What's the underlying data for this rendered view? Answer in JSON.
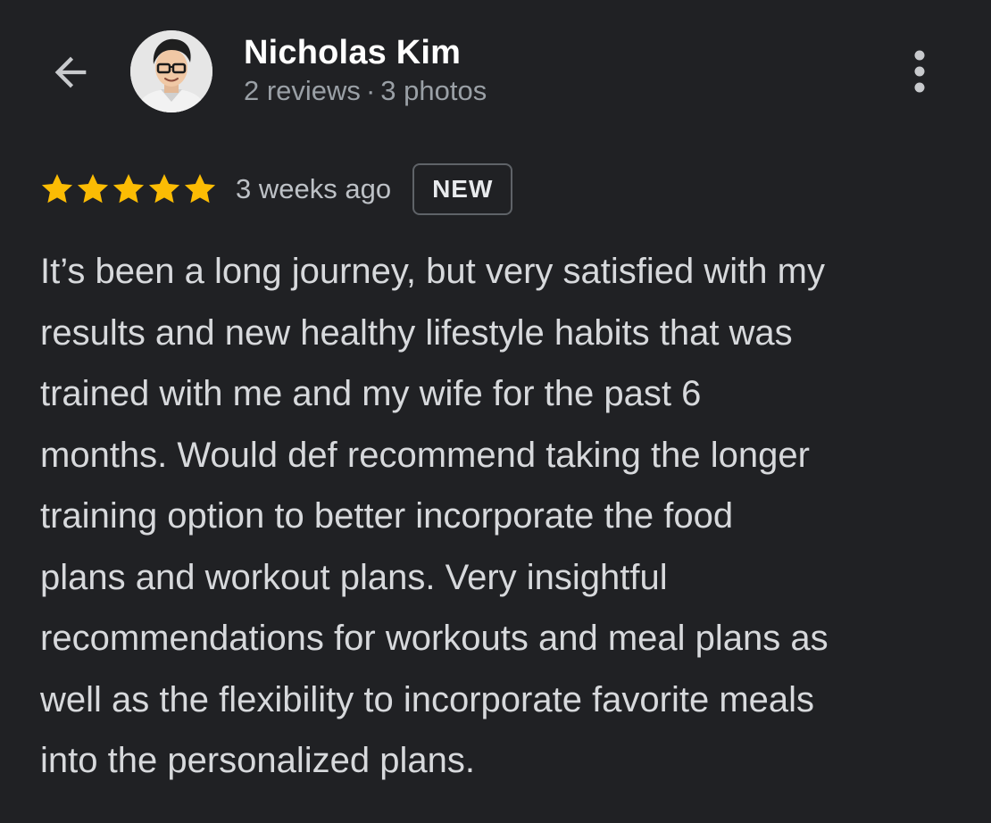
{
  "header": {
    "back_icon": "arrow-back-icon",
    "avatar_icon": "profile-photo",
    "reviewer_name": "Nicholas Kim",
    "reviews_count": "2 reviews",
    "separator": "·",
    "photos_count": "3 photos",
    "more_icon": "more-vert-icon"
  },
  "review": {
    "rating": 5,
    "rating_max": 5,
    "star_color": "#fbbc04",
    "time_ago": "3 weeks ago",
    "badge": "NEW",
    "lines": [
      "It’s been a long journey, but very satisfied with my",
      "results and new healthy lifestyle habits that was",
      "trained with me and my wife for the past 6",
      "months. Would def recommend taking the longer",
      "training option to better incorporate the food",
      "plans and workout plans. Very insightful",
      "recommendations for workouts and meal plans as",
      "well as the flexibility to incorporate favorite meals",
      "into the personalized plans."
    ]
  },
  "colors": {
    "background": "#202124",
    "primary_text": "#ffffff",
    "secondary_text": "#9aa0a6",
    "body_text": "#d7d9dc"
  }
}
